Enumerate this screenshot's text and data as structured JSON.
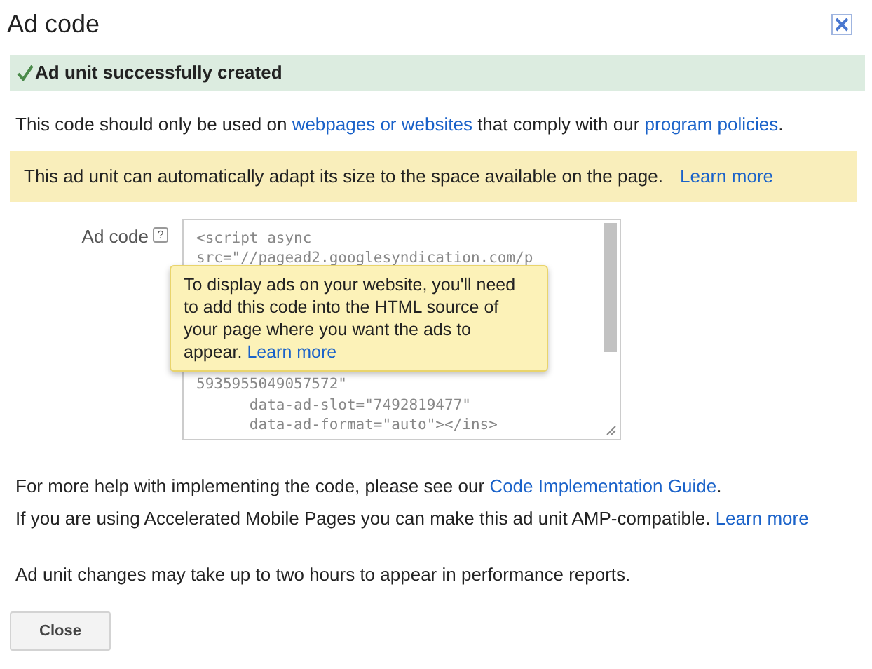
{
  "window": {
    "title": "Ad code"
  },
  "success_banner": {
    "text": "Ad unit successfully created"
  },
  "notice": [
    {
      "text": "This code should only be used on ",
      "link": false
    },
    {
      "text": "webpages or websites",
      "link": true
    },
    {
      "text": " that comply with our ",
      "link": false
    },
    {
      "text": "program policies",
      "link": true
    },
    {
      "text": ".",
      "link": false
    }
  ],
  "info_banner": {
    "text": "This ad unit can automatically adapt its size to the space available on the page.",
    "link": "Learn more"
  },
  "ad_code": {
    "label": "Ad code",
    "help": "?",
    "top_lines": [
      "<script async",
      "src=\"//pagead2.googlesyndication.com/p"
    ],
    "bottom_lines": [
      "5935955049057572\"",
      "      data-ad-slot=\"7492819477\"",
      "      data-ad-format=\"auto\"></ins>"
    ],
    "tooltip": {
      "text": "To display ads on your website, you'll need to add this code into the HTML source of your page where you want the ads to appear.",
      "link": "Learn more"
    }
  },
  "help_lines": [
    [
      {
        "text": "For more help with implementing the code, please see our ",
        "link": false
      },
      {
        "text": "Code Implementation Guide",
        "link": true
      },
      {
        "text": ".",
        "link": false
      }
    ],
    [
      {
        "text": "If you are using Accelerated Mobile Pages you can make this ad unit AMP-compatible. ",
        "link": false
      },
      {
        "text": "Learn more",
        "link": true
      }
    ]
  ],
  "footnote": "Ad unit changes may take up to two hours to appear in performance reports.",
  "buttons": [
    "Close"
  ]
}
